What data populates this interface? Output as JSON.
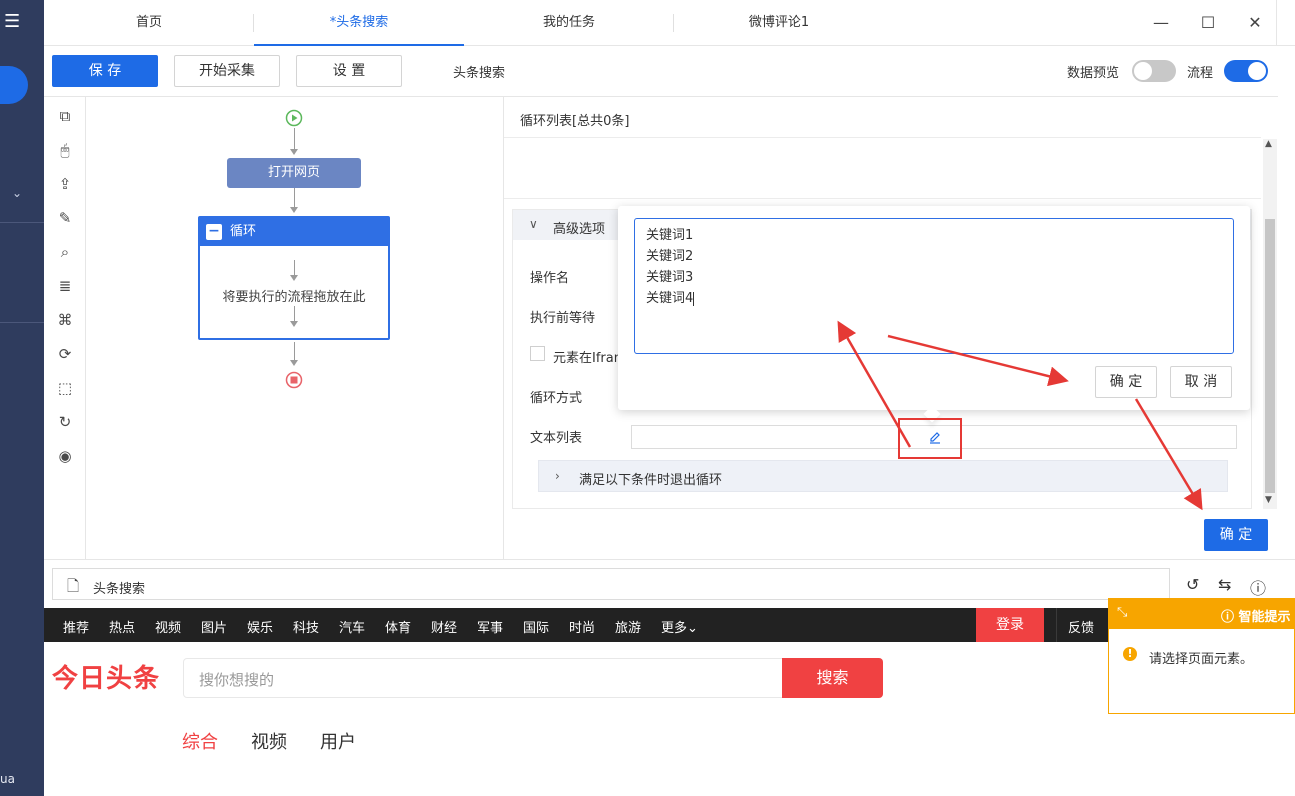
{
  "window": {
    "tabs": [
      {
        "label": "首页"
      },
      {
        "label": "*头条搜索"
      },
      {
        "label": "我的任务"
      },
      {
        "label": "微博评论1"
      }
    ]
  },
  "toolbar": {
    "save_label": "保 存",
    "start_label": "开始采集",
    "settings_label": "设 置",
    "task_name": "头条搜索",
    "data_preview_label": "数据预览",
    "flow_label": "流程",
    "data_preview_on": false,
    "flow_on": true
  },
  "left_nav": {
    "bottom_text": "ua"
  },
  "flow": {
    "open_page_label": "打开网页",
    "loop_label": "循环",
    "loop_placeholder": "将要执行的流程拖放在此"
  },
  "panel": {
    "list_title": "循环列表[总共0条]",
    "advanced_label": "高级选项",
    "op_name_label": "操作名",
    "wait_label": "执行前等待",
    "iframe_label": "元素在Ifram",
    "loop_mode_label": "循环方式",
    "text_list_label": "文本列表",
    "exit_condition_label": "满足以下条件时退出循环",
    "confirm_label": "确 定"
  },
  "popup": {
    "lines": [
      "关键词1",
      "关键词2",
      "关键词3",
      "关键词4"
    ],
    "ok_label": "确 定",
    "cancel_label": "取 消"
  },
  "address_bar": {
    "value": "头条搜索"
  },
  "site": {
    "nav_items": [
      "推荐",
      "热点",
      "视频",
      "图片",
      "娱乐",
      "科技",
      "汽车",
      "体育",
      "财经",
      "军事",
      "国际",
      "时尚",
      "旅游",
      "更多"
    ],
    "login_label": "登录",
    "feedback_label": "反馈",
    "logo_text": "今日头条",
    "search_placeholder": "搜你想搜的",
    "search_button": "搜索",
    "search_tabs": [
      "综合",
      "视频",
      "用户"
    ]
  },
  "tip": {
    "title": "智能提示",
    "message": "请选择页面元素。"
  },
  "colors": {
    "accent": "#1e6be6",
    "toutiao_red": "#f04142",
    "tip_orange": "#f7a500",
    "annotation_red": "#e53935"
  }
}
